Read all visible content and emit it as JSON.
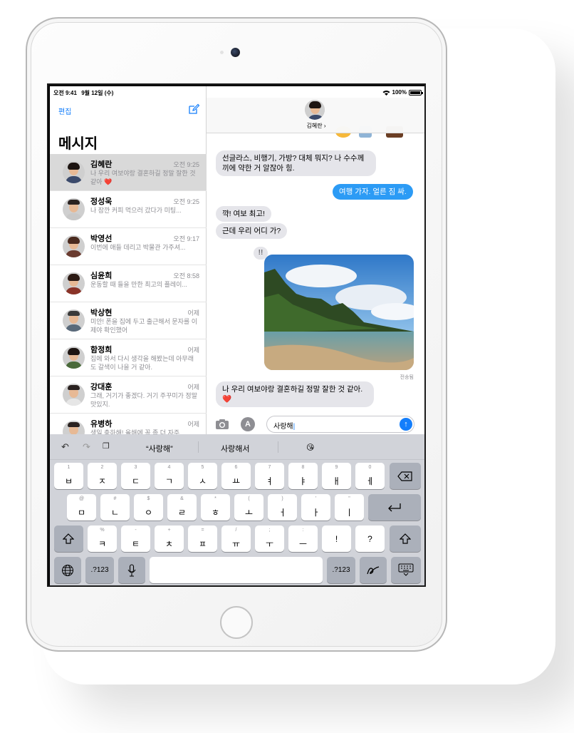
{
  "status_bar": {
    "time": "오전 9:41",
    "date": "9월 12일 (수)",
    "battery": "100%"
  },
  "sidebar": {
    "edit_label": "편집",
    "title": "메시지",
    "conversations": [
      {
        "name": "김혜란",
        "time": "오전 9:25",
        "preview": "나 우리 여보야랑 결혼하길 정말 잘한 것 같아 ❤️"
      },
      {
        "name": "정성욱",
        "time": "오전 9:25",
        "preview": "나 잠깐 커피 먹으러 갔다가 미팅..."
      },
      {
        "name": "박영선",
        "time": "오전 9:17",
        "preview": "이번에 애들 데리고 박물관 가주셔..."
      },
      {
        "name": "심윤희",
        "time": "오전 8:58",
        "preview": "운동할 때 들을 만한 최고의 플레이..."
      },
      {
        "name": "박상현",
        "time": "어제",
        "preview": "미안! 폰을 집에 두고 출근해서 문자를 이제야 확인했어"
      },
      {
        "name": "함정희",
        "time": "어제",
        "preview": "집에 와서 다시 생각을 해봤는데 아무래도 갈색이 나을 거 같아."
      },
      {
        "name": "강대훈",
        "time": "어제",
        "preview": "그래, 거기가 좋겠다. 거기 주꾸미가 정말 맛있지."
      },
      {
        "name": "유병하",
        "time": "어제",
        "preview": "생일 축하해! 올해에 꼭 좀 더 자주"
      }
    ]
  },
  "conversation": {
    "contact_name": "김혜란 ›",
    "messages": [
      {
        "from": "in",
        "text": "선글라스, 비행기, 가방? 대체 뭐지? 나 수수께끼에 약한 거 알잖아 힝."
      },
      {
        "from": "out",
        "text": "여행 가자. 얼른 짐 싸."
      },
      {
        "from": "in",
        "text": "꺅! 여보 최고!"
      },
      {
        "from": "in",
        "text": "근데 우리 어디 가?"
      },
      {
        "from": "in",
        "text": "나 우리 여보야랑 결혼하길 정말 잘한 것 같아. ❤️"
      }
    ],
    "tapback": "!!",
    "delivered_label": "전송됨",
    "input_value": "사랑해"
  },
  "keyboard": {
    "predictions": [
      "“사랑해”",
      "사랑해서",
      "😘"
    ],
    "row1": [
      {
        "sub": "1",
        "main": "ㅂ"
      },
      {
        "sub": "2",
        "main": "ㅈ"
      },
      {
        "sub": "3",
        "main": "ㄷ"
      },
      {
        "sub": "4",
        "main": "ㄱ"
      },
      {
        "sub": "5",
        "main": "ㅅ"
      },
      {
        "sub": "6",
        "main": "ㅛ"
      },
      {
        "sub": "7",
        "main": "ㅕ"
      },
      {
        "sub": "8",
        "main": "ㅑ"
      },
      {
        "sub": "9",
        "main": "ㅐ"
      },
      {
        "sub": "0",
        "main": "ㅔ"
      }
    ],
    "row2": [
      {
        "sub": "@",
        "main": "ㅁ"
      },
      {
        "sub": "#",
        "main": "ㄴ"
      },
      {
        "sub": "$",
        "main": "ㅇ"
      },
      {
        "sub": "&",
        "main": "ㄹ"
      },
      {
        "sub": "*",
        "main": "ㅎ"
      },
      {
        "sub": "(",
        "main": "ㅗ"
      },
      {
        "sub": ")",
        "main": "ㅓ"
      },
      {
        "sub": "'",
        "main": "ㅏ"
      },
      {
        "sub": "\"",
        "main": "ㅣ"
      }
    ],
    "row3": [
      {
        "sub": "%",
        "main": "ㅋ"
      },
      {
        "sub": "-",
        "main": "ㅌ"
      },
      {
        "sub": "+",
        "main": "ㅊ"
      },
      {
        "sub": "=",
        "main": "ㅍ"
      },
      {
        "sub": "/",
        "main": "ㅠ"
      },
      {
        "sub": ";",
        "main": "ㅜ"
      },
      {
        "sub": ":",
        "main": "ㅡ"
      },
      {
        "sub": "!",
        "main": "!"
      },
      {
        "sub": "?",
        "main": "?"
      }
    ],
    "numbers_label": ".?123",
    "icons": {
      "globe": "globe-icon",
      "mic": "microphone-icon",
      "delete": "delete-icon",
      "return": "return-icon",
      "shift": "shift-icon",
      "handwriting": "handwriting-icon",
      "hide": "keyboard-hide-icon"
    }
  },
  "colors": {
    "accent": "#147efb",
    "outgoing_bubble": "#2c9bf5",
    "incoming_bubble": "#e5e5ea",
    "keyboard_bg": "#d1d3d9"
  }
}
